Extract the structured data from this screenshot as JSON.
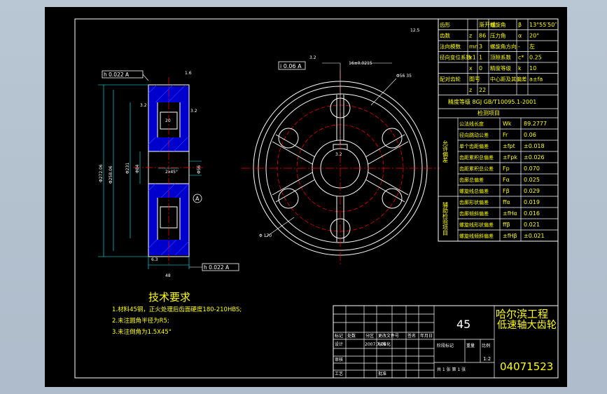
{
  "colors": {
    "viewport": "#b9c6d3",
    "sheet": "#000000",
    "frame": "#ffffff",
    "text": "#ffff00",
    "dim": "#00ffff",
    "center": "#ff0000",
    "hatch": "#0000ff",
    "annotation": "#ffffff"
  },
  "gear_params": [
    {
      "k1": "齿形",
      "v1": "渐开线",
      "k2": "螺旋角",
      "s2": "β",
      "v2": "13°55′50″"
    },
    {
      "k1": "齿数",
      "s1": "z",
      "v1": "86",
      "k2": "压力角",
      "s2": "α",
      "v2": "20°"
    },
    {
      "k1": "法向模数",
      "s1": "mn",
      "v1": "3",
      "k2": "螺旋角方向",
      "s2": "-",
      "v2": "左"
    },
    {
      "k1": "径向变位系数",
      "s1": "x1",
      "v1": "1",
      "k2": "顶隙系数",
      "s2": "c*",
      "v2": "0.25"
    },
    {
      "k1": "",
      "s1": "x",
      "v1": "0",
      "k2": "精度等级",
      "s2": "k",
      "v2": "10"
    },
    {
      "k1": "配对齿轮",
      "s1": "图号",
      "v1": "",
      "k2": "中心距及其偏差",
      "s2": "",
      "v2": "a±fa"
    },
    {
      "k1": "",
      "s1": "z",
      "v1": "22",
      "k2": "",
      "s2": "",
      "v2": ""
    }
  ],
  "accuracy_std": "精度等级 8GJ GB/T10095.1-2001",
  "inspection_title": "检测项目",
  "allow_label": "允许偏差",
  "aux_label": "辅助检验项目",
  "inspection_rows": [
    {
      "name": "公法线长度",
      "sym": "Wk",
      "val": "89.2777"
    },
    {
      "name": "径向跳动公差",
      "sym": "Fr",
      "val": "0.06"
    },
    {
      "name": "单个齿距偏差",
      "sym": "±fpt",
      "val": "±0.018"
    },
    {
      "name": "齿距累积总偏差",
      "sym": "±Fpk",
      "val": "±0.026"
    },
    {
      "name": "齿距累积总公差",
      "sym": "Fp",
      "val": "0.070"
    },
    {
      "name": "齿廓总偏差",
      "sym": "Fα",
      "val": "0.025"
    },
    {
      "name": "螺旋线总偏差",
      "sym": "Fβ",
      "val": "0.029"
    },
    {
      "name": "齿廓形状偏差",
      "sym": "ffα",
      "val": "0.019"
    },
    {
      "name": "齿廓倾斜偏差",
      "sym": "±fHα",
      "val": "0.016"
    },
    {
      "name": "螺旋线形状偏差",
      "sym": "ffβ",
      "val": "0.021"
    },
    {
      "name": "螺旋线倾斜偏差",
      "sym": "±fHβ",
      "val": "±0.021"
    }
  ],
  "tech": {
    "title": "技术要求",
    "lines": [
      "1.材料45钢，正火处理后齿面硬度180-210HBS;",
      "2.未注圆角半径为R5;",
      "3.未注倒角为1.5X45°"
    ]
  },
  "title_block": {
    "material": "45",
    "company": "哈尔滨工程",
    "part_name": "低速轴大齿轮",
    "drawing_no": "04071523",
    "scale": "1:2",
    "sheets": "共 1 张    第 1 张",
    "row_labels": [
      "标记",
      "处数",
      "分区",
      "更改文件号",
      "签名",
      "年月日"
    ],
    "row2": [
      "设计",
      "",
      "2007.7.06",
      "标准化",
      "",
      ""
    ],
    "row3": [
      "审核",
      "",
      "",
      "",
      "",
      ""
    ],
    "row4": [
      "工艺",
      "",
      "",
      "批准",
      "",
      ""
    ],
    "stage_label": "阶段标记",
    "weight_label": "重量",
    "scale_label": "比例"
  },
  "annotations": {
    "gdt_left_top": "h 0.022 A",
    "gdt_left_bottom": "h 0.022 A",
    "gdt_right": "i 0.06 A",
    "key_tol": "16±0.0215",
    "bore_dia": "Φ56  35",
    "rim_dia": "Φ 170",
    "datum": "A",
    "dim_outer": "Φ272.06",
    "dim_root": "Φ258.06",
    "dim_mid": "Φ231",
    "dim_hub": "Φ84",
    "dim_width": "48",
    "dim_web": "20",
    "dim_chamfer": "2x45°",
    "dim_bore": "Φ56",
    "roughness_1": "3.2",
    "roughness_2": "1.6",
    "roughness_top": "12.5",
    "roughness_left": "6.3"
  }
}
